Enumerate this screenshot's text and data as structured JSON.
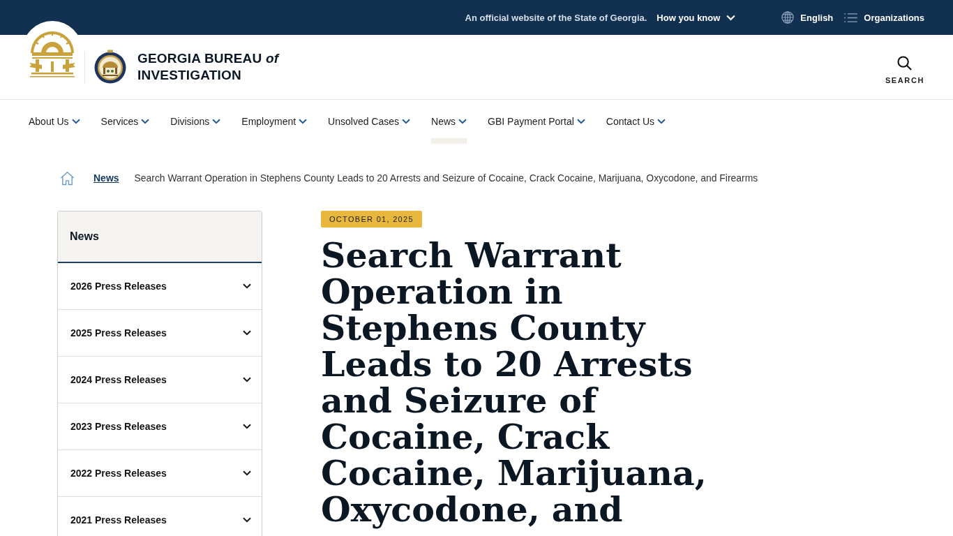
{
  "official_banner": {
    "notice": "An official website of the State of Georgia.",
    "how_you_know": "How you know",
    "language": "English",
    "organizations": "Organizations"
  },
  "header": {
    "site_name": [
      "GEORGIA BUREAU *of*",
      "INVESTIGATION"
    ],
    "search_label": "SEARCH"
  },
  "nav": [
    {
      "label": "About Us",
      "selected": false
    },
    {
      "label": "Services",
      "selected": false
    },
    {
      "label": "Divisions",
      "selected": false
    },
    {
      "label": "Employment",
      "selected": false
    },
    {
      "label": "Unsolved Cases",
      "selected": false
    },
    {
      "label": "News",
      "selected": true
    },
    {
      "label": "GBI Payment Portal",
      "selected": false
    },
    {
      "label": "Contact Us",
      "selected": false
    }
  ],
  "breadcrumb": [
    {
      "kind": "link",
      "label": "News"
    },
    {
      "kind": "current",
      "label": "Search Warrant Operation in Stephens County Leads to 20 Arrests and Seizure of Cocaine, Crack Cocaine, Marijuana, Oxycodone, and Firearms"
    }
  ],
  "sidebar": {
    "title": "News",
    "items": [
      {
        "label": "2026 Press Releases"
      },
      {
        "label": "2025 Press Releases"
      },
      {
        "label": "2024 Press Releases"
      },
      {
        "label": "2023 Press Releases"
      },
      {
        "label": "2022 Press Releases"
      },
      {
        "label": "2021 Press Releases"
      }
    ]
  },
  "article": {
    "date": "OCTOBER 01, 2025",
    "title": "Search Warrant Operation in Stephens County Leads to 20 Arrests and Seizure of Cocaine, Crack Cocaine, Marijuana, Oxycodone, and"
  }
}
